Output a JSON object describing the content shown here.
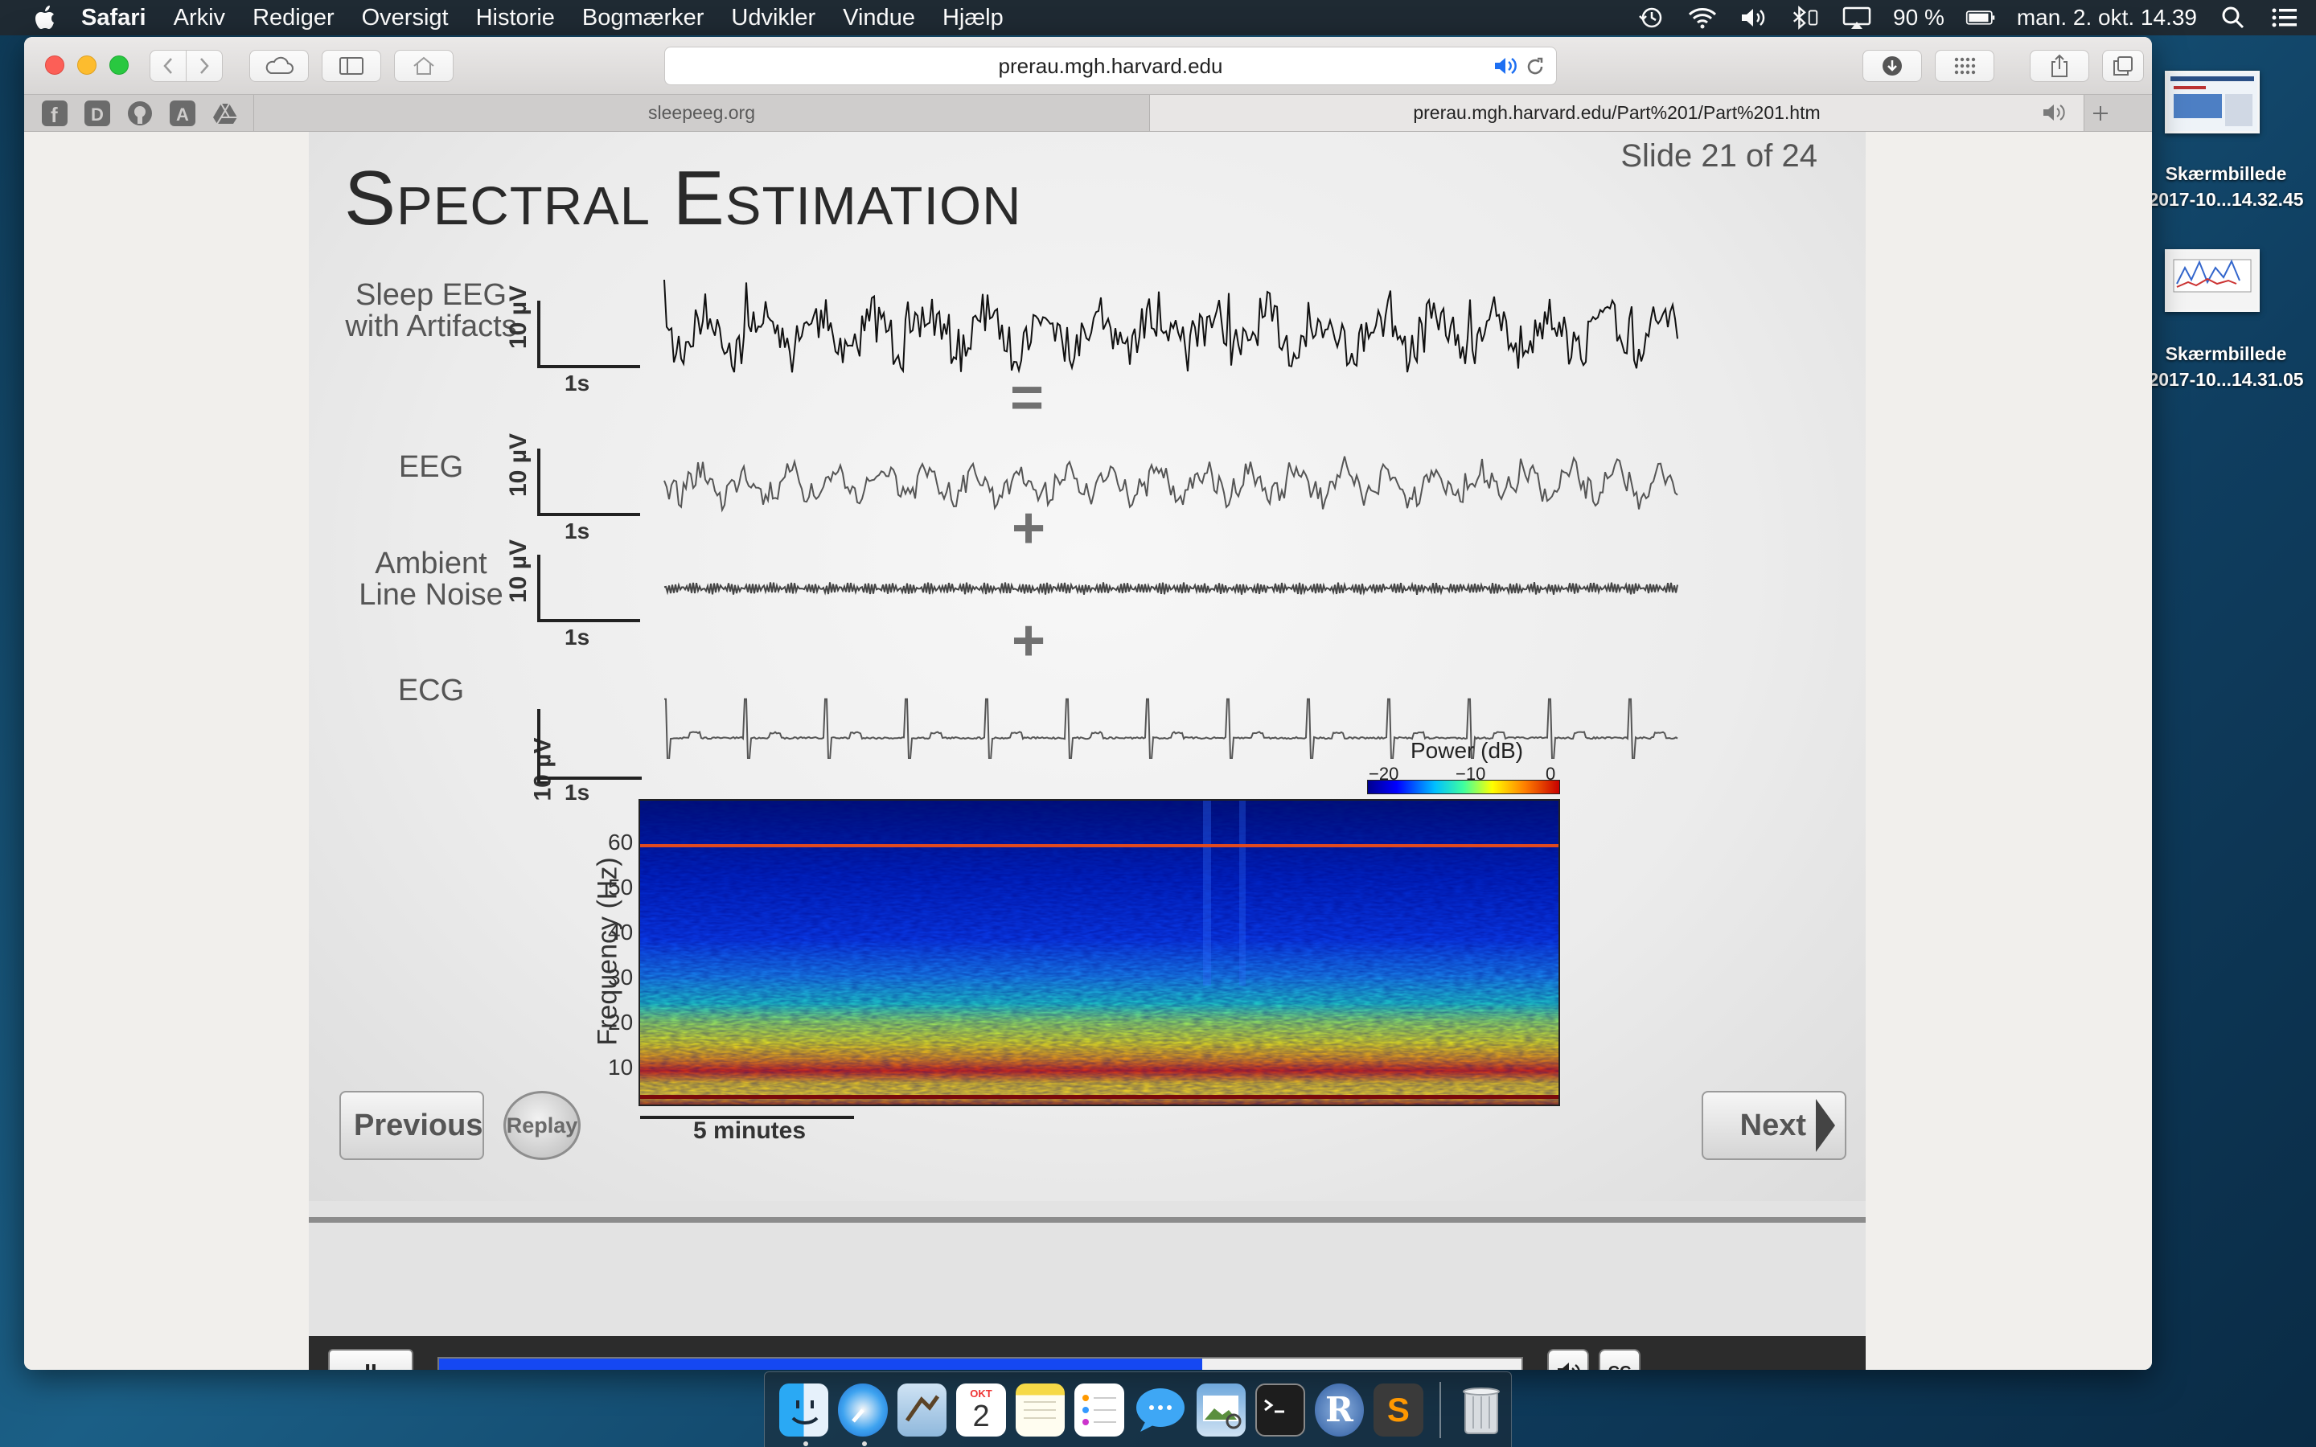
{
  "menubar": {
    "app_name": "Safari",
    "items": [
      "Arkiv",
      "Rediger",
      "Oversigt",
      "Historie",
      "Bogmærker",
      "Udvikler",
      "Vindue",
      "Hjælp"
    ],
    "battery": "90 %",
    "clock": "man. 2. okt.  14.39"
  },
  "browser": {
    "address": "prerau.mgh.harvard.edu",
    "tabs": [
      {
        "label": "sleepeeg.org",
        "active": false
      },
      {
        "label": "prerau.mgh.harvard.edu/Part%201/Part%201.htm",
        "active": true
      }
    ],
    "favorites_icons": [
      "facebook-icon",
      "d-icon",
      "github-icon",
      "a-icon",
      "drive-icon"
    ]
  },
  "slide": {
    "counter": "Slide 21 of 24",
    "title": "Spectral Estimation",
    "signals": [
      {
        "label": "Sleep EEG with Artifacts",
        "scale": "10 µV",
        "time": "1s"
      },
      {
        "label": "EEG",
        "scale": "10 µV",
        "time": "1s"
      },
      {
        "label": "Ambient Line Noise",
        "scale": "10 µV",
        "time": "1s"
      },
      {
        "label": "ECG",
        "scale": "10 µV",
        "time": "1s"
      }
    ],
    "operators": [
      "=",
      "+",
      "+"
    ],
    "spectrogram": {
      "ylabel": "Frequency (Hz)",
      "yticks": [
        "60",
        "50",
        "40",
        "30",
        "20",
        "10"
      ],
      "scalebar": "5 minutes",
      "colorbar_title": "Power (dB)",
      "colorbar_ticks": [
        "−20",
        "−10",
        "0"
      ]
    },
    "nav": {
      "previous": "Previous",
      "replay": "Replay",
      "next": "Next"
    }
  },
  "player": {
    "progress_fraction": 0.705,
    "pause_label": "II",
    "cc_label": "CC"
  },
  "desktop": {
    "files": [
      "Skærmbillede 2017-10...14.32.45",
      "Skærmbillede 2017-10...14.31.05"
    ],
    "file_line1": [
      "Skærmbillede",
      "Skærmbillede"
    ],
    "file_line2": [
      "2017-10...14.32.45",
      "2017-10...14.31.05"
    ]
  },
  "dock": {
    "apps": [
      "finder-icon",
      "safari-icon",
      "mail-icon",
      "calendar-icon",
      "notes-icon",
      "reminders-icon",
      "messages-icon",
      "preview-icon",
      "terminal-icon",
      "r-icon",
      "sublime-icon",
      "trash-icon"
    ],
    "calendar_month": "OKT",
    "calendar_day": "2",
    "r_letter": "R",
    "sublime_letter": "S"
  }
}
